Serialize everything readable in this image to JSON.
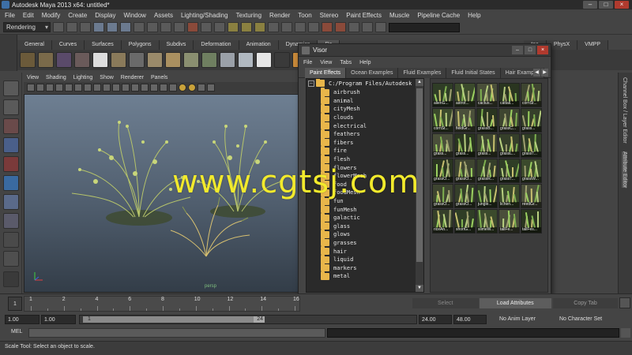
{
  "window": {
    "title": "Autodesk Maya 2013 x64: untitled*"
  },
  "menubar": [
    "File",
    "Edit",
    "Modify",
    "Create",
    "Display",
    "Window",
    "Assets",
    "Lighting/Shading",
    "Texturing",
    "Render",
    "Toon",
    "Stereo",
    "Paint Effects",
    "Muscle",
    "Pipeline Cache",
    "Help"
  ],
  "status_line": {
    "mode": "Rendering"
  },
  "shelf": {
    "tabs": [
      "General",
      "Curves",
      "Surfaces",
      "Polygons",
      "Subdivs",
      "Deformation",
      "Animation",
      "Dynamics",
      "Re"
    ],
    "right_tabs": [
      "toa",
      "PhysX",
      "VMPP"
    ]
  },
  "viewport": {
    "menu": [
      "View",
      "Shading",
      "Lighting",
      "Show",
      "Renderer",
      "Panels"
    ],
    "camera_label": "persp"
  },
  "visor": {
    "title": "Visor",
    "menu": [
      "File",
      "View",
      "Tabs",
      "Help"
    ],
    "tabs": [
      "Paint Effects",
      "Ocean Examples",
      "Fluid Examples",
      "Fluid Initial States",
      "Hair Example"
    ],
    "root_path": "C:/Program Files/Autodesk",
    "folders": [
      "airbrush",
      "animal",
      "cityMesh",
      "clouds",
      "electrical",
      "feathers",
      "fibers",
      "fire",
      "flesh",
      "flowers",
      "flowerMesh",
      "food",
      "foodMesh",
      "fun",
      "funMesh",
      "galactic",
      "glass",
      "glows",
      "grasses",
      "hair",
      "liquid",
      "markers",
      "metal"
    ],
    "thumbnails": [
      [
        "alienG...",
        "astrot...",
        "cactus...",
        "cattail...",
        "cornSt..."
      ],
      [
        "cornSt...",
        "fieldGr...",
        "grassB...",
        "grassC...",
        "grass..."
      ],
      [
        "grass...",
        "grass...",
        "grass...",
        "grassL...",
        "grassT..."
      ],
      [
        "grassO...",
        "grassO...",
        "grassR...",
        "grassT...",
        "grassW..."
      ],
      [
        "grassO...",
        "grassO...",
        "jungle...",
        "lichen...",
        "reedGr..."
      ],
      [
        "riceAn...",
        "shortG...",
        "slimeW...",
        "tallFe...",
        "tallFes..."
      ]
    ],
    "bottom_buttons": {
      "select": "Select",
      "load_attributes": "Load Attributes"
    }
  },
  "right_panel": {
    "channel_box_tab": "Channel Box / Layer Editor",
    "attribute_editor_tab": "Attribute Editor",
    "copy_tab": "Copy Tab"
  },
  "time_slider": {
    "ticks": [
      "1",
      "2",
      "4",
      "6",
      "8",
      "10",
      "12",
      "14",
      "16"
    ],
    "current_frame": "1"
  },
  "range_slider": {
    "start_time": "1.00",
    "playback_start": "1.00",
    "range_start_label": "1",
    "range_end_label": "24",
    "playback_end": "24.00",
    "end_time": "48.00",
    "anim_layer": "No Anim Layer",
    "character_set": "No Character Set"
  },
  "command_line": {
    "label": "MEL"
  },
  "help_line": {
    "text": "Scale Tool: Select an object to scale."
  },
  "watermark": "www.cgtsj.com",
  "colors": {
    "watermark": "#f2ea2c",
    "folder": "#e8b64a",
    "viewport_top": "#6e7f92",
    "close_button": "#b03a2e"
  }
}
